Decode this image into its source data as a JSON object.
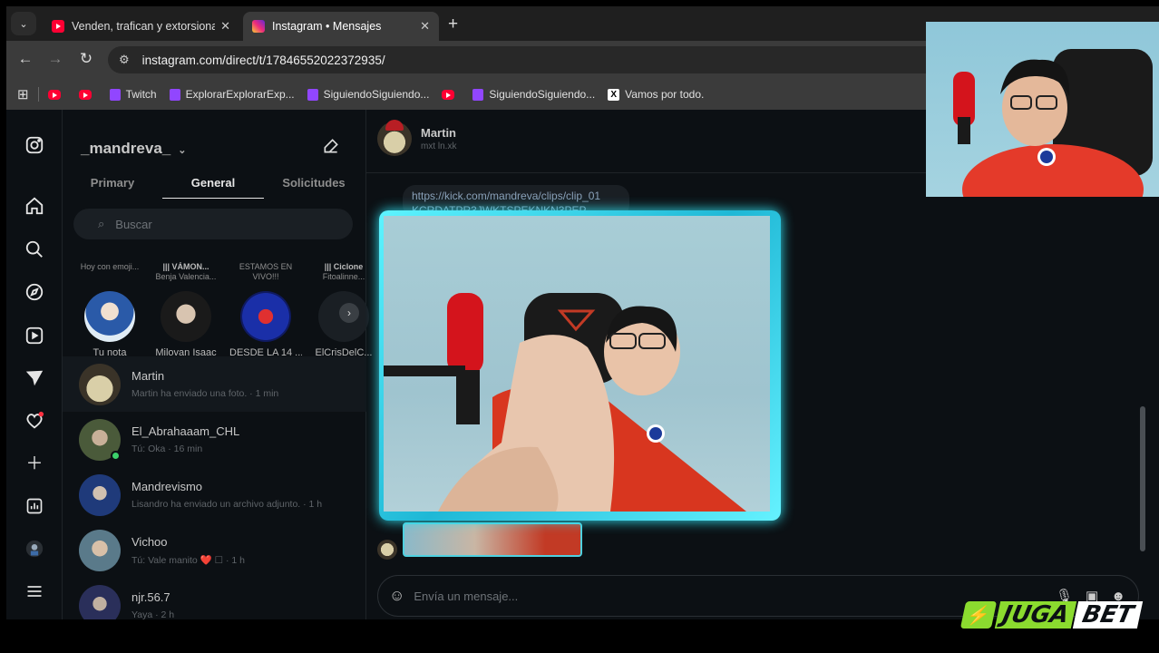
{
  "browser": {
    "tabs": [
      {
        "title": "Venden, trafican y extorsionan:",
        "active": false,
        "favicon": "youtube-icon"
      },
      {
        "title": "Instagram • Mensajes",
        "active": true,
        "favicon": "instagram-icon"
      }
    ],
    "new_tab": "+",
    "close": "✕",
    "url": "instagram.com/direct/t/17846552022372935/",
    "bookmarks": [
      {
        "label": "",
        "icon": "youtube-icon"
      },
      {
        "label": "",
        "icon": "youtube-icon"
      },
      {
        "label": "Twitch",
        "icon": "twitch-icon"
      },
      {
        "label": "ExplorarExplorarExp...",
        "icon": "twitch-icon"
      },
      {
        "label": "SiguiendoSiguiendo...",
        "icon": "twitch-icon"
      },
      {
        "label": "",
        "icon": "youtube-icon"
      },
      {
        "label": "SiguiendoSiguiendo...",
        "icon": "twitch-icon"
      },
      {
        "label": "Vamos por todo.",
        "icon": "x-icon"
      }
    ]
  },
  "instagram": {
    "username": "_mandreva_",
    "tabs": [
      "Primary",
      "General",
      "Solicitudes"
    ],
    "active_tab": "General",
    "search_placeholder": "Buscar",
    "notes": [
      {
        "bubble": "Hoy con emoji...",
        "bubble_bold": "",
        "name": "Tu nota"
      },
      {
        "bubble": "Benja Valencia...",
        "bubble_bold": "||| VÁMON...",
        "name": "Milovan Isaac"
      },
      {
        "bubble": "ESTAMOS EN VIVO!!!",
        "bubble_bold": "",
        "name": "DESDE LA 14 ..."
      },
      {
        "bubble": "Fitoalinne...",
        "bubble_bold": "||| Ciclone",
        "name": "ElCrisDelC..."
      }
    ],
    "chats": [
      {
        "name": "Martin",
        "preview": "Martin ha enviado una foto. · 1 min",
        "selected": true,
        "online": false
      },
      {
        "name": "El_Abrahaaam_CHL",
        "preview": "Tú: Oka · 16 min",
        "selected": false,
        "online": true
      },
      {
        "name": "Mandrevismo",
        "preview": "Lisandro ha enviado un archivo adjunto. · 1 h",
        "selected": false,
        "online": false
      },
      {
        "name": "Vichoo",
        "preview": "Tú: Vale manito ❤️ ☐ · 1 h",
        "selected": false,
        "online": false
      },
      {
        "name": "njr.56.7",
        "preview": "Yaya · 2 h",
        "selected": false,
        "online": false
      }
    ],
    "thread": {
      "name": "Martin",
      "subtitle": "mxt ln.xk",
      "link_message": "https://kick.com/mandreva/clips/clip_01 KCRDATPR3JWKTSPEKNKN3PEP",
      "composer_placeholder": "Envía un mensaje..."
    }
  },
  "sponsor": {
    "part1": "JUGA",
    "part2": "BET"
  },
  "colors": {
    "accent_cyan": "#4fe3f2",
    "brand_green": "#8bdb2f",
    "ig_bg": "#0c1014"
  }
}
